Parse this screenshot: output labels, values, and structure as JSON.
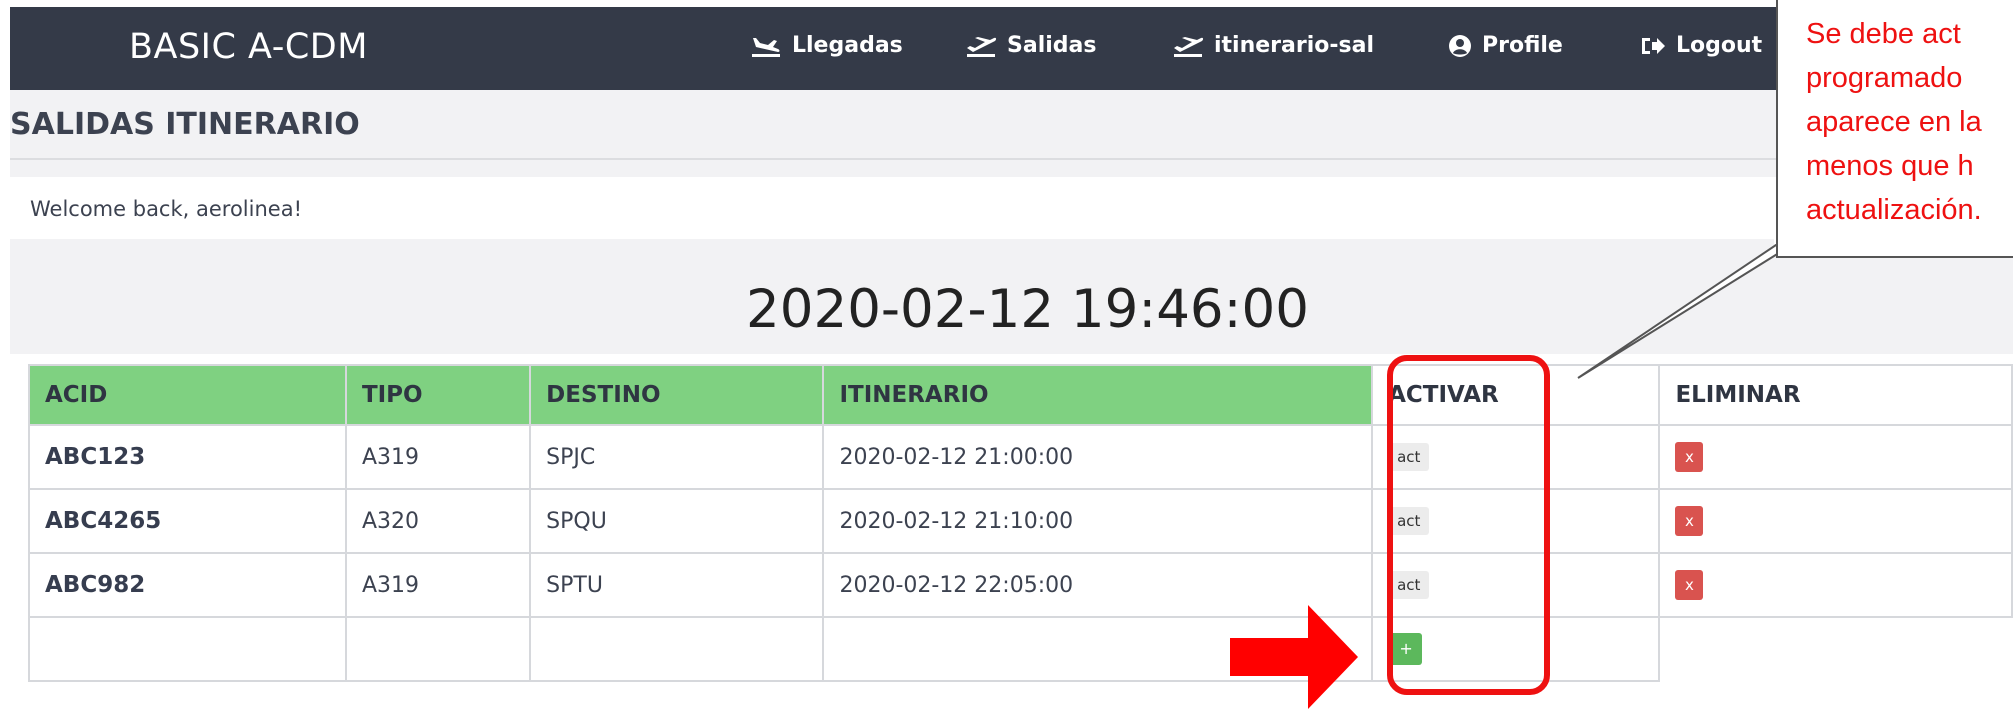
{
  "navbar": {
    "brand": "BASIC A-CDM",
    "items": [
      {
        "label": "Llegadas",
        "icon": "plane-arrival-icon"
      },
      {
        "label": "Salidas",
        "icon": "plane-departure-icon"
      },
      {
        "label": "itinerario-sal",
        "icon": "plane-departure-icon"
      },
      {
        "label": "Profile",
        "icon": "user-circle-icon"
      },
      {
        "label": "Logout",
        "icon": "sign-out-icon"
      }
    ]
  },
  "page": {
    "title": "SALIDAS ITINERARIO",
    "welcome": "Welcome back, aerolinea!",
    "clock": "2020-02-12 19:46:00"
  },
  "table": {
    "headers": [
      "ACID",
      "TIPO",
      "DESTINO",
      "ITINERARIO",
      "ACTIVAR",
      "ELIMINAR"
    ],
    "rows": [
      {
        "acid": "ABC123",
        "tipo": "A319",
        "destino": "SPJC",
        "itinerario": "2020-02-12 21:00:00",
        "activar": "act",
        "eliminar": "x"
      },
      {
        "acid": "ABC4265",
        "tipo": "A320",
        "destino": "SPQU",
        "itinerario": "2020-02-12 21:10:00",
        "activar": "act",
        "eliminar": "x"
      },
      {
        "acid": "ABC982",
        "tipo": "A319",
        "destino": "SPTU",
        "itinerario": "2020-02-12 22:05:00",
        "activar": "act",
        "eliminar": "x"
      }
    ],
    "add_label": "+"
  },
  "annotation": {
    "lines": [
      "Se debe act",
      "programado",
      "aparece en la",
      "menos que h",
      "actualización."
    ]
  },
  "colors": {
    "navbar": "#343a48",
    "header_green": "#7fd181",
    "danger": "#d9534f",
    "success": "#5cb85c",
    "annotation_red": "#ee1111"
  }
}
